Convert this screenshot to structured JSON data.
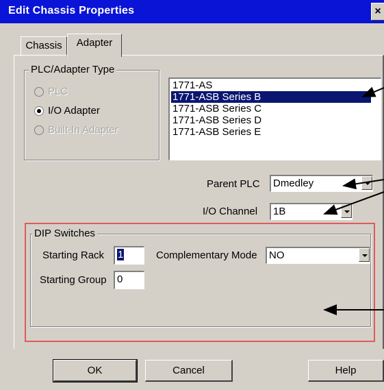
{
  "window": {
    "title": "Edit Chassis Properties",
    "close_glyph": "×"
  },
  "tabs": [
    {
      "label": "Chassis",
      "active": false
    },
    {
      "label": "Adapter",
      "active": true
    }
  ],
  "plc_adapter_type": {
    "legend": "PLC/Adapter Type",
    "options": [
      {
        "label": "PLC",
        "checked": false,
        "enabled": false
      },
      {
        "label": "I/O Adapter",
        "checked": true,
        "enabled": true
      },
      {
        "label": "Built-In Adapter",
        "checked": false,
        "enabled": false
      }
    ]
  },
  "series_list": {
    "items": [
      "1771-AS",
      "1771-ASB Series B",
      "1771-ASB Series C",
      "1771-ASB Series D",
      "1771-ASB Series E"
    ],
    "selected": "1771-ASB Series B"
  },
  "parent_plc": {
    "label": "Parent PLC",
    "value": "Dmedley"
  },
  "io_channel": {
    "label": "I/O Channel",
    "value": "1B"
  },
  "dip_switches": {
    "legend": "DIP Switches",
    "starting_rack_label": "Starting Rack",
    "starting_rack_value": "1",
    "starting_group_label": "Starting Group",
    "starting_group_value": "0",
    "complementary_mode_label": "Complementary Mode",
    "complementary_mode_value": "NO"
  },
  "buttons": {
    "ok": "OK",
    "cancel": "Cancel",
    "help": "Help"
  },
  "colors": {
    "title_bar": "#0a14d6",
    "selection": "#0a1670",
    "annotation_box": "#e05a5a",
    "dialog_face": "#d4d0c8"
  }
}
